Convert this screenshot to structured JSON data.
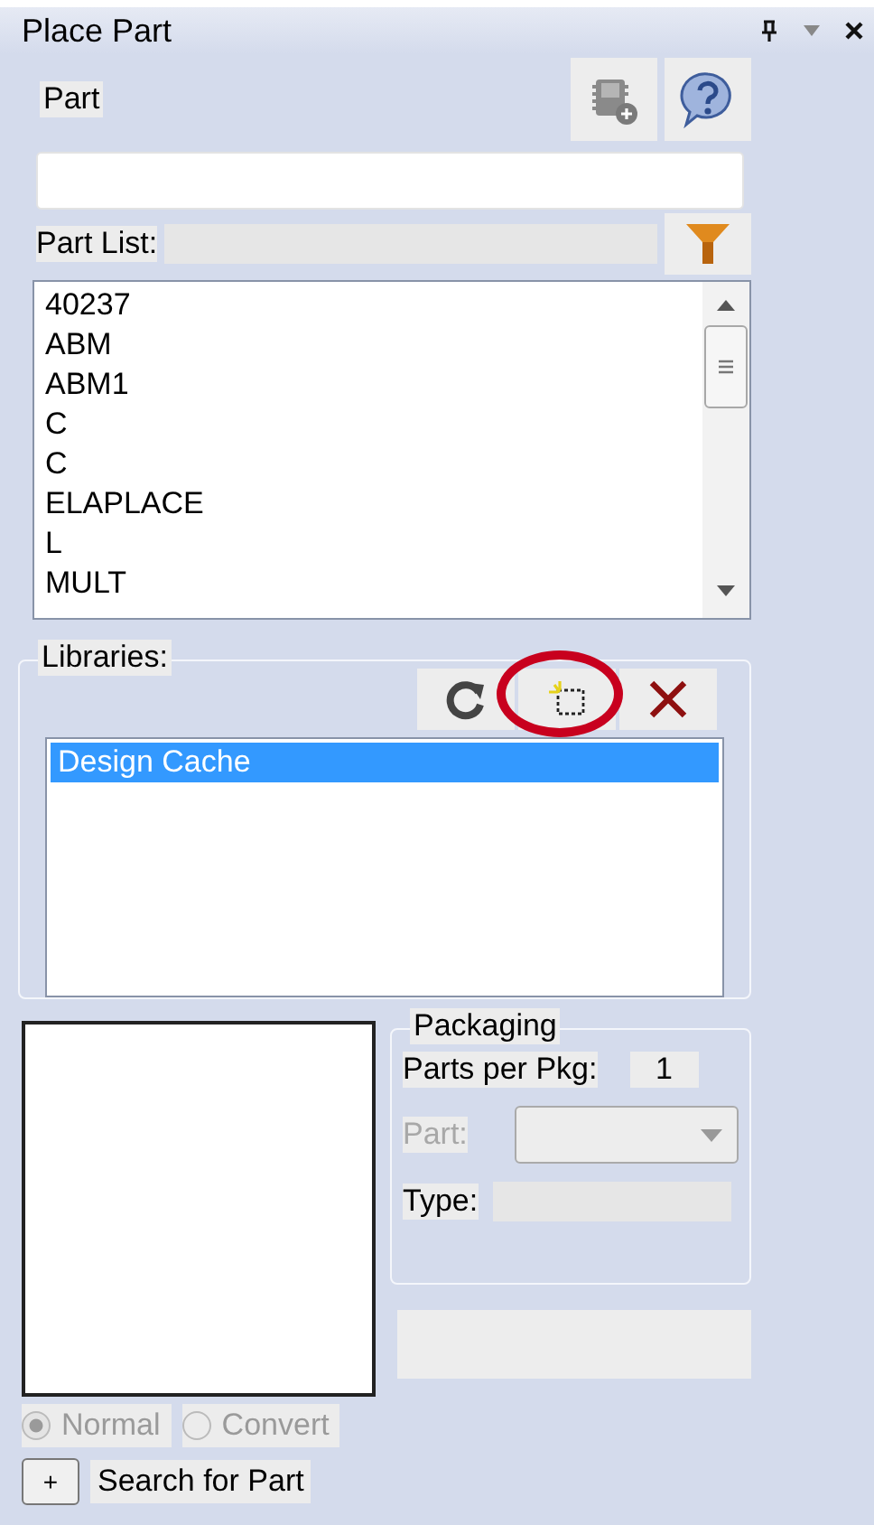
{
  "window": {
    "title": "Place Part"
  },
  "part": {
    "label": "Part"
  },
  "part_list": {
    "label": "Part List:",
    "items": [
      {
        "name": "40237",
        "selected": false
      },
      {
        "name": "ABM",
        "selected": false
      },
      {
        "name": "ABM1",
        "selected": false
      },
      {
        "name": "C",
        "selected": false
      },
      {
        "name": "C",
        "selected": false
      },
      {
        "name": "ELAPLACE",
        "selected": false
      },
      {
        "name": "L",
        "selected": false
      },
      {
        "name": "MULT",
        "selected": false
      }
    ]
  },
  "libraries": {
    "label": "Libraries:",
    "highlight": {
      "kind": "ring",
      "color": "#c8001e"
    },
    "items": [
      {
        "name": "Design Cache",
        "selected": true
      }
    ]
  },
  "packaging": {
    "label": "Packaging",
    "parts_per_pkg_label": "Parts per Pkg:",
    "parts_per_pkg": "1",
    "part_label": "Part:",
    "part_disabled": true,
    "type_label": "Type:"
  },
  "views": [
    {
      "label": "Normal",
      "selected": true,
      "disabled": true
    },
    {
      "label": "Convert",
      "selected": false,
      "disabled": true
    }
  ],
  "search": {
    "toggle": "+",
    "label": "Search for Part"
  }
}
